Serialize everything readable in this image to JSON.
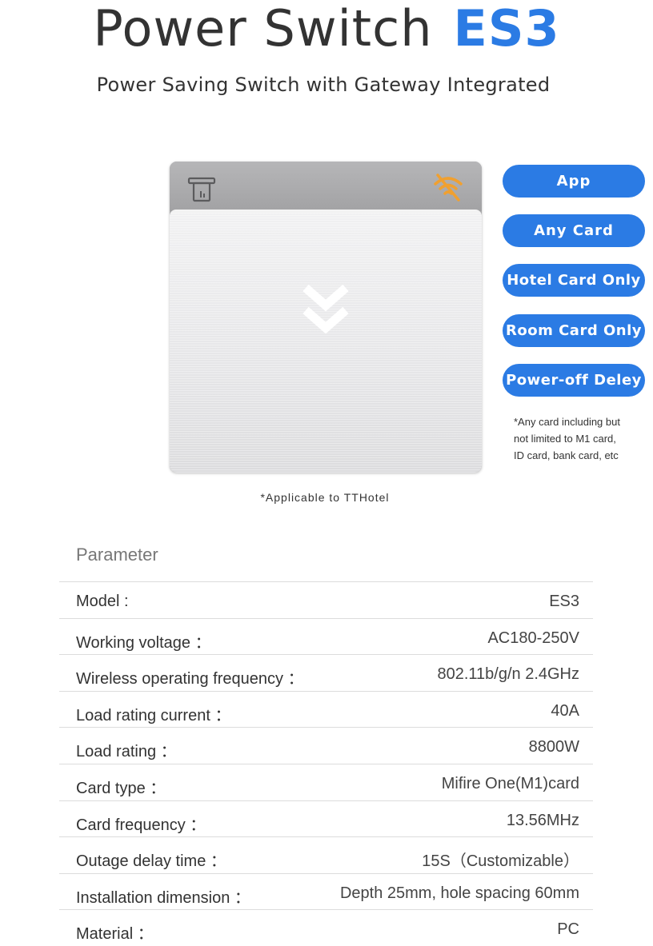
{
  "header": {
    "title": "Power Switch",
    "model": "ES3",
    "subtitle": "Power Saving Switch with Gateway Integrated"
  },
  "colors": {
    "accent": "#2b7be4",
    "wifi_off": "#f0a030"
  },
  "device": {
    "icons": [
      "card-slot-icon",
      "wifi-off-icon",
      "double-chevron-down-icon"
    ]
  },
  "modes": [
    {
      "label": "App"
    },
    {
      "label": "Any Card"
    },
    {
      "label": "Hotel Card Only"
    },
    {
      "label": "Room Card Only"
    },
    {
      "label": "Power-off Deley"
    }
  ],
  "note": {
    "line1": "*Any card including but",
    "line2": "not limited to M1 card,",
    "line3": "ID card, bank card, etc"
  },
  "applicable": "*Applicable to TTHotel",
  "parameters": {
    "heading": "Parameter",
    "rows": [
      {
        "label": "Model :",
        "value": "ES3"
      },
      {
        "label": "Working voltage ：",
        "value": "AC180-250V"
      },
      {
        "label": "Wireless operating frequency ：",
        "value": "802.11b/g/n  2.4GHz"
      },
      {
        "label": "Load rating current ：",
        "value": "40A"
      },
      {
        "label": "Load rating ：",
        "value": "8800W"
      },
      {
        "label": "Card type ：",
        "value": "Mifire One(M1)card"
      },
      {
        "label": "Card frequency ：",
        "value": "13.56MHz"
      },
      {
        "label": "Outage delay time ：",
        "value": "15S（Customizable）"
      },
      {
        "label": "Installation dimension ：",
        "value": "Depth 25mm, hole spacing 60mm"
      },
      {
        "label": "Material ：",
        "value": "PC"
      }
    ]
  }
}
